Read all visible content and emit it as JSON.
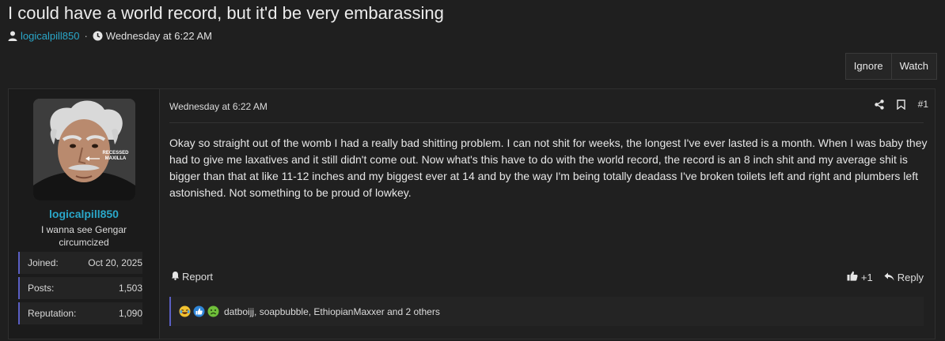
{
  "thread": {
    "title": "I could have a world record, but it'd be very embarassing",
    "author": "logicalpill850",
    "separator": "·",
    "date": "Wednesday at 6:22 AM"
  },
  "actions": {
    "ignore": "Ignore",
    "watch": "Watch"
  },
  "user": {
    "name": "logicalpill850",
    "title": "I wanna see Gengar circumcized",
    "avatar_caption": "RECESSED MAXILLA",
    "stats": [
      {
        "label": "Joined:",
        "value": "Oct 20, 2025"
      },
      {
        "label": "Posts:",
        "value": "1,503"
      },
      {
        "label": "Reputation:",
        "value": "1,090"
      }
    ]
  },
  "post": {
    "date": "Wednesday at 6:22 AM",
    "number": "#1",
    "body": "Okay so straight out of the womb I had a really bad shitting problem. I can not shit for weeks, the longest I've ever lasted is a month. When I was baby they had to give me laxatives and it still didn't come out. Now what's this have to do with the world record, the record is an 8 inch shit and my average shit is bigger than that at like 11-12 inches and my biggest ever at 14 and by the way I'm being totally deadass I've broken toilets left and right and plumbers left astonished. Not something to be proud of lowkey.",
    "report": "Report",
    "like_count": "+1",
    "reply": "Reply",
    "reacted_by": "datboijj, soapbubble, EthiopianMaxxer and 2 others"
  },
  "colors": {
    "accent": "#2aa7c9",
    "stat_bar": "#5a5fc4",
    "background": "#1f1f1f"
  }
}
